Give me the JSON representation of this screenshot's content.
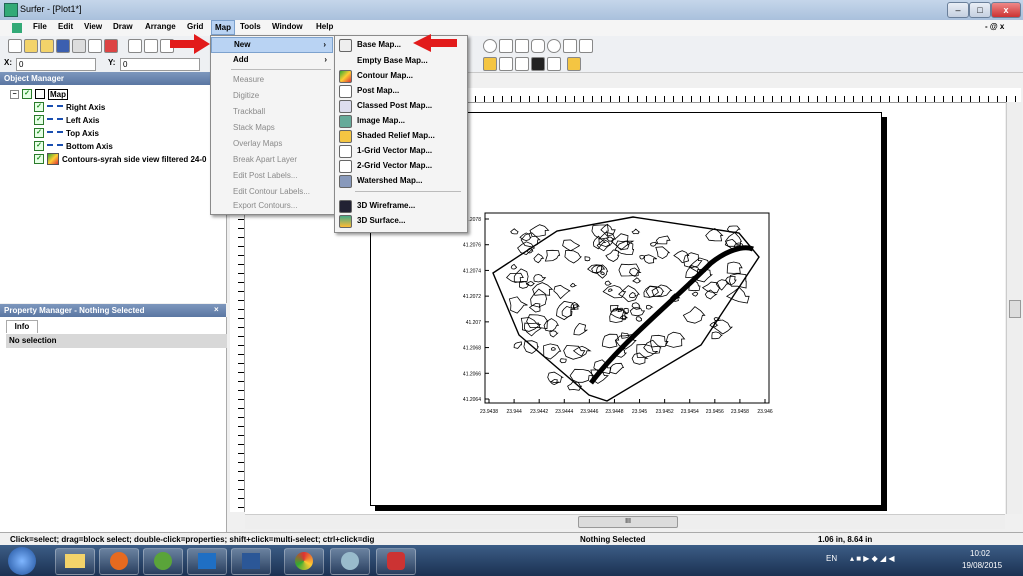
{
  "window": {
    "title": "Surfer - [Plot1*]",
    "min": "–",
    "max": "□",
    "close": "x",
    "mdi_controls": "- @ x"
  },
  "menubar": [
    "File",
    "Edit",
    "View",
    "Draw",
    "Arrange",
    "Grid",
    "Map",
    "Tools",
    "Window",
    "Help"
  ],
  "coords": {
    "x_label": "X:",
    "x_value": "0",
    "y_label": "Y:",
    "y_value": "0"
  },
  "object_manager": {
    "title": "Object Manager",
    "root": "Map",
    "items": [
      "Right Axis",
      "Left Axis",
      "Top Axis",
      "Bottom Axis",
      "Contours-syrah side view filtered 24-0"
    ]
  },
  "property_manager": {
    "title": "Property Manager - Nothing Selected",
    "tab": "Info",
    "selection": "No selection"
  },
  "map_menu": {
    "items": [
      {
        "label": "New",
        "arrow": "›",
        "state": "highlight"
      },
      {
        "label": "Add",
        "arrow": "›",
        "state": "enabled"
      },
      {
        "label": "Measure",
        "state": "disabled"
      },
      {
        "label": "Digitize",
        "state": "disabled"
      },
      {
        "label": "Trackball",
        "state": "disabled"
      },
      {
        "label": "Stack Maps",
        "state": "disabled"
      },
      {
        "label": "Overlay Maps",
        "state": "disabled"
      },
      {
        "label": "Break Apart Layer",
        "state": "disabled"
      },
      {
        "label": "Edit Post Labels...",
        "state": "disabled"
      },
      {
        "label": "Edit Contour Labels...",
        "state": "disabled"
      },
      {
        "label": "Export Contours...",
        "state": "disabled"
      }
    ]
  },
  "new_submenu": {
    "items": [
      "Base Map...",
      "Empty Base Map...",
      "Contour Map...",
      "Post Map...",
      "Classed Post Map...",
      "Image Map...",
      "Shaded Relief Map...",
      "1-Grid Vector Map...",
      "2-Grid Vector Map...",
      "Watershed Map...",
      "3D Wireframe...",
      "3D Surface..."
    ]
  },
  "plot": {
    "y_ticks": [
      "41.2078",
      "41.2076",
      "41.2074",
      "41.2072",
      "41.207",
      "41.2068",
      "41.2066",
      "41.2064"
    ],
    "x_ticks": [
      "23.9438",
      "23.944",
      "23.9442",
      "23.9444",
      "23.9446",
      "23.9448",
      "23.945",
      "23.9452",
      "23.9454",
      "23.9456",
      "23.9458",
      "23.946"
    ]
  },
  "hscroll_label": "III",
  "status": {
    "hint": "Click=select; drag=block select; double-click=properties; shift+click=multi-select; ctrl+click=dig",
    "selection": "Nothing Selected",
    "position": "1.06 in, 8.64 in"
  },
  "tray": {
    "lang": "EN",
    "time": "10:02",
    "date": "19/08/2015"
  },
  "colors": {
    "highlight": "#b9d3f3",
    "title_gradient": "#a9c0dc",
    "taskbar": "#1b3152",
    "arrow": "#e21b1b"
  }
}
